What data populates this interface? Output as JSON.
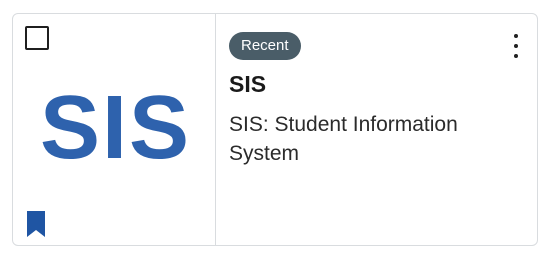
{
  "card": {
    "logo_text": "SIS",
    "badge": "Recent",
    "title": "SIS",
    "description": "SIS: Student Information System",
    "icons": {
      "checkbox": "checkbox-icon",
      "bookmark": "bookmark-icon",
      "more": "more-vertical-icon"
    }
  },
  "colors": {
    "logo": "#2e62ad",
    "badge_bg": "#4a5d68",
    "bookmark": "#1f55a3",
    "border": "#d9dcdf"
  }
}
